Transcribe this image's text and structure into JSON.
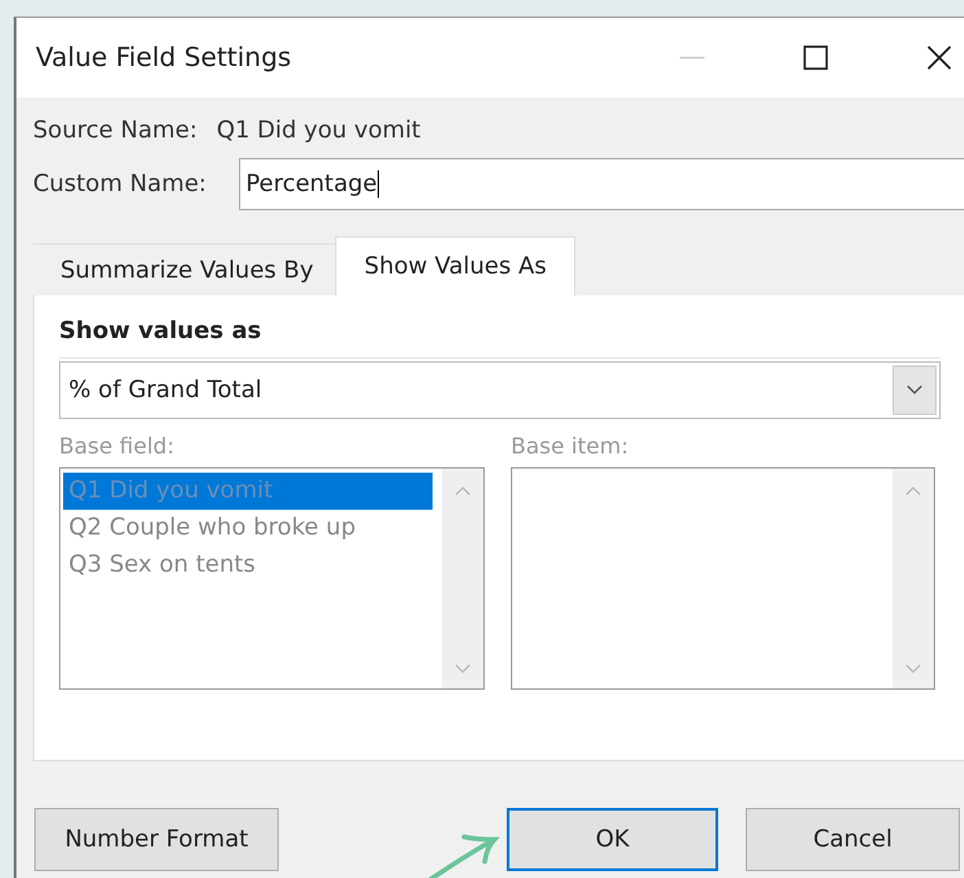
{
  "window": {
    "title": "Value Field Settings"
  },
  "source": {
    "label": "Source Name:",
    "value": "Q1 Did you vomit"
  },
  "custom_name": {
    "label": "Custom Name:",
    "value": "Percentage"
  },
  "tabs": [
    {
      "label": "Summarize Values By",
      "selected": false
    },
    {
      "label": "Show Values As",
      "selected": true
    }
  ],
  "show_values_as": {
    "heading": "Show values as",
    "value": "% of Grand Total"
  },
  "base_field": {
    "label": "Base field:",
    "disabled": true,
    "items": [
      {
        "label": "Q1 Did you vomit",
        "selected": true
      },
      {
        "label": "Q2 Couple who broke up",
        "selected": false
      },
      {
        "label": "Q3 Sex on tents",
        "selected": false
      }
    ]
  },
  "base_item": {
    "label": "Base item:",
    "disabled": true
  },
  "buttons": [
    {
      "label": "Number Format",
      "default": false
    },
    {
      "label": "OK",
      "default": true
    },
    {
      "label": "Cancel",
      "default": false
    }
  ]
}
